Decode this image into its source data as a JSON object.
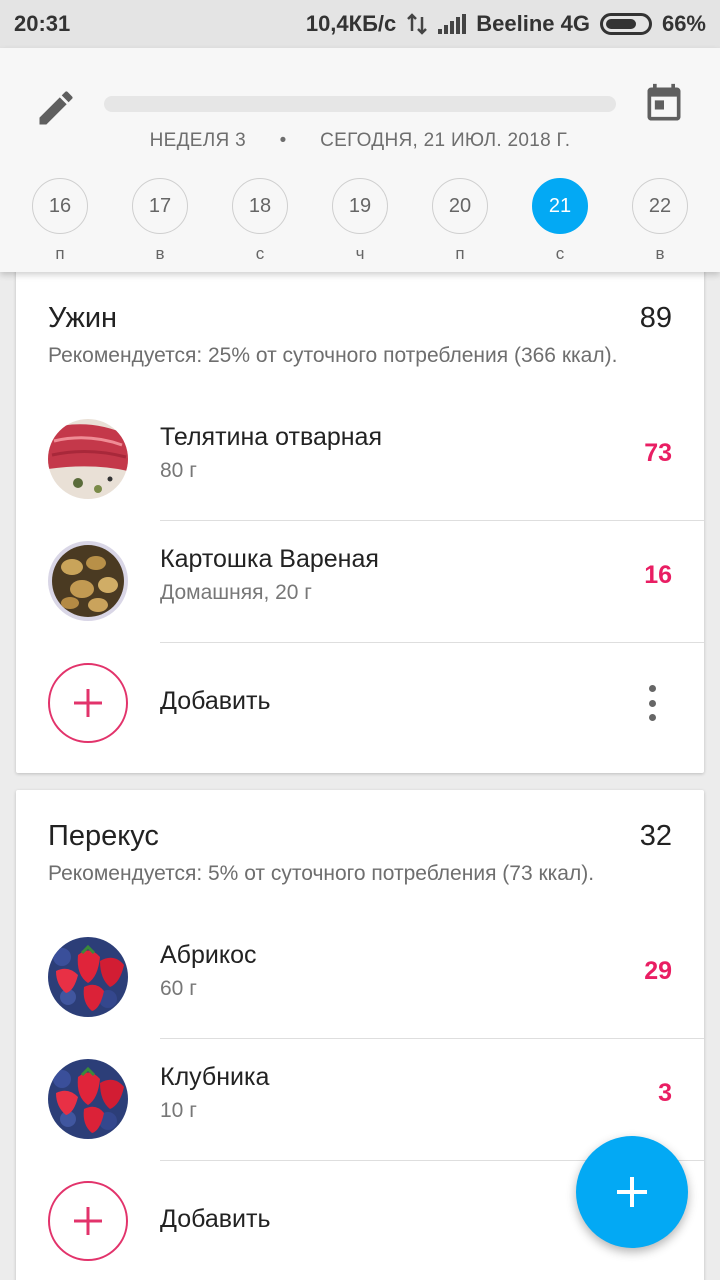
{
  "status_bar": {
    "time": "20:31",
    "speed": "10,4КБ/с",
    "carrier": "Beeline 4G",
    "battery": "66%"
  },
  "header": {
    "week_label": "НЕДЕЛЯ 3",
    "separator": "•",
    "date_label": "СЕГОДНЯ, 21 ИЮЛ. 2018 Г.",
    "days": [
      {
        "num": "16",
        "letter": "п"
      },
      {
        "num": "17",
        "letter": "в"
      },
      {
        "num": "18",
        "letter": "с"
      },
      {
        "num": "19",
        "letter": "ч"
      },
      {
        "num": "20",
        "letter": "п"
      },
      {
        "num": "21",
        "letter": "с"
      },
      {
        "num": "22",
        "letter": "в"
      }
    ],
    "selected_day": "21",
    "accent_color": "#03a9f4"
  },
  "meals": [
    {
      "title": "Ужин",
      "total": "89",
      "recommendation": "Рекомендуется: 25% от суточного потребления (366 ккал).",
      "items": [
        {
          "name": "Телятина отварная",
          "amount": "80 г",
          "calories": "73",
          "icon": "veal-photo"
        },
        {
          "name": "Картошка Вареная",
          "amount": "Домашняя, 20 г",
          "calories": "16",
          "icon": "potato-photo"
        }
      ],
      "add_label": "Добавить"
    },
    {
      "title": "Перекус",
      "total": "32",
      "recommendation": "Рекомендуется: 5% от суточного потребления (73 ккал).",
      "items": [
        {
          "name": "Абрикос",
          "amount": "60 г",
          "calories": "29",
          "icon": "berries-photo"
        },
        {
          "name": "Клубника",
          "amount": "10 г",
          "calories": "3",
          "icon": "berries-photo"
        }
      ],
      "add_label": "Добавить"
    }
  ],
  "calorie_color": "#e91e63"
}
